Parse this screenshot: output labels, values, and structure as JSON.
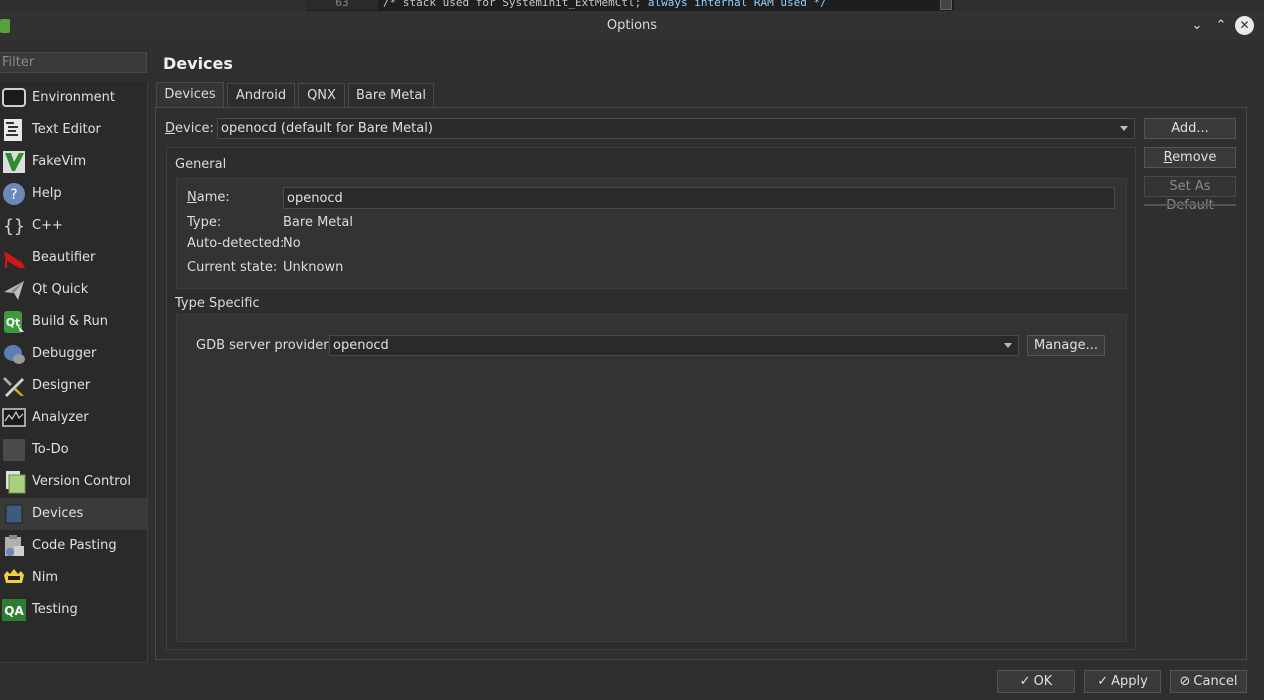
{
  "editor_strip": {
    "line_number": "63",
    "code_plain": "/* stack used for SystemInit_ExtMemCtl;",
    "code_keyword": " always internal RAM used */"
  },
  "window": {
    "title": "Options"
  },
  "filter": {
    "placeholder": "Filter"
  },
  "categories": [
    {
      "label": "Environment",
      "icon": "monitor-icon"
    },
    {
      "label": "Text Editor",
      "icon": "text-editor-icon"
    },
    {
      "label": "FakeVim",
      "icon": "fakevim-icon"
    },
    {
      "label": "Help",
      "icon": "help-icon"
    },
    {
      "label": "C++",
      "icon": "braces-icon"
    },
    {
      "label": "Beautifier",
      "icon": "beautifier-icon"
    },
    {
      "label": "Qt Quick",
      "icon": "qt-quick-icon"
    },
    {
      "label": "Build & Run",
      "icon": "build-run-icon"
    },
    {
      "label": "Debugger",
      "icon": "debugger-icon"
    },
    {
      "label": "Designer",
      "icon": "designer-icon"
    },
    {
      "label": "Analyzer",
      "icon": "analyzer-icon"
    },
    {
      "label": "To-Do",
      "icon": "todo-icon"
    },
    {
      "label": "Version Control",
      "icon": "version-control-icon"
    },
    {
      "label": "Devices",
      "icon": "devices-icon"
    },
    {
      "label": "Code Pasting",
      "icon": "code-pasting-icon"
    },
    {
      "label": "Nim",
      "icon": "nim-icon"
    },
    {
      "label": "Testing",
      "icon": "testing-icon"
    }
  ],
  "selected_category": "Devices",
  "page": {
    "title": "Devices",
    "tabs": [
      {
        "label": "Devices",
        "active": true
      },
      {
        "label": "Android",
        "active": false
      },
      {
        "label": "QNX",
        "active": false
      },
      {
        "label": "Bare Metal",
        "active": false
      }
    ],
    "device_label_mnemonic": "D",
    "device_label_rest": "evice:",
    "device_value": "openocd (default for Bare Metal)",
    "buttons": {
      "add": "Add...",
      "remove_mnemonic": "R",
      "remove_rest": "emove",
      "set_default": "Set As Default"
    },
    "general": {
      "title": "General",
      "name_label_mnemonic": "N",
      "name_label_rest": "ame:",
      "name_value": "openocd",
      "type_label": "Type:",
      "type_value": "Bare Metal",
      "autodetected_label": "Auto-detected:",
      "autodetected_value": "No",
      "state_label": "Current state:",
      "state_value": "Unknown"
    },
    "type_specific": {
      "title": "Type Specific",
      "gdb_label": "GDB server provider:",
      "gdb_value": "openocd",
      "manage": "Manage..."
    }
  },
  "footer": {
    "ok": "OK",
    "apply": "Apply",
    "cancel": "Cancel"
  }
}
